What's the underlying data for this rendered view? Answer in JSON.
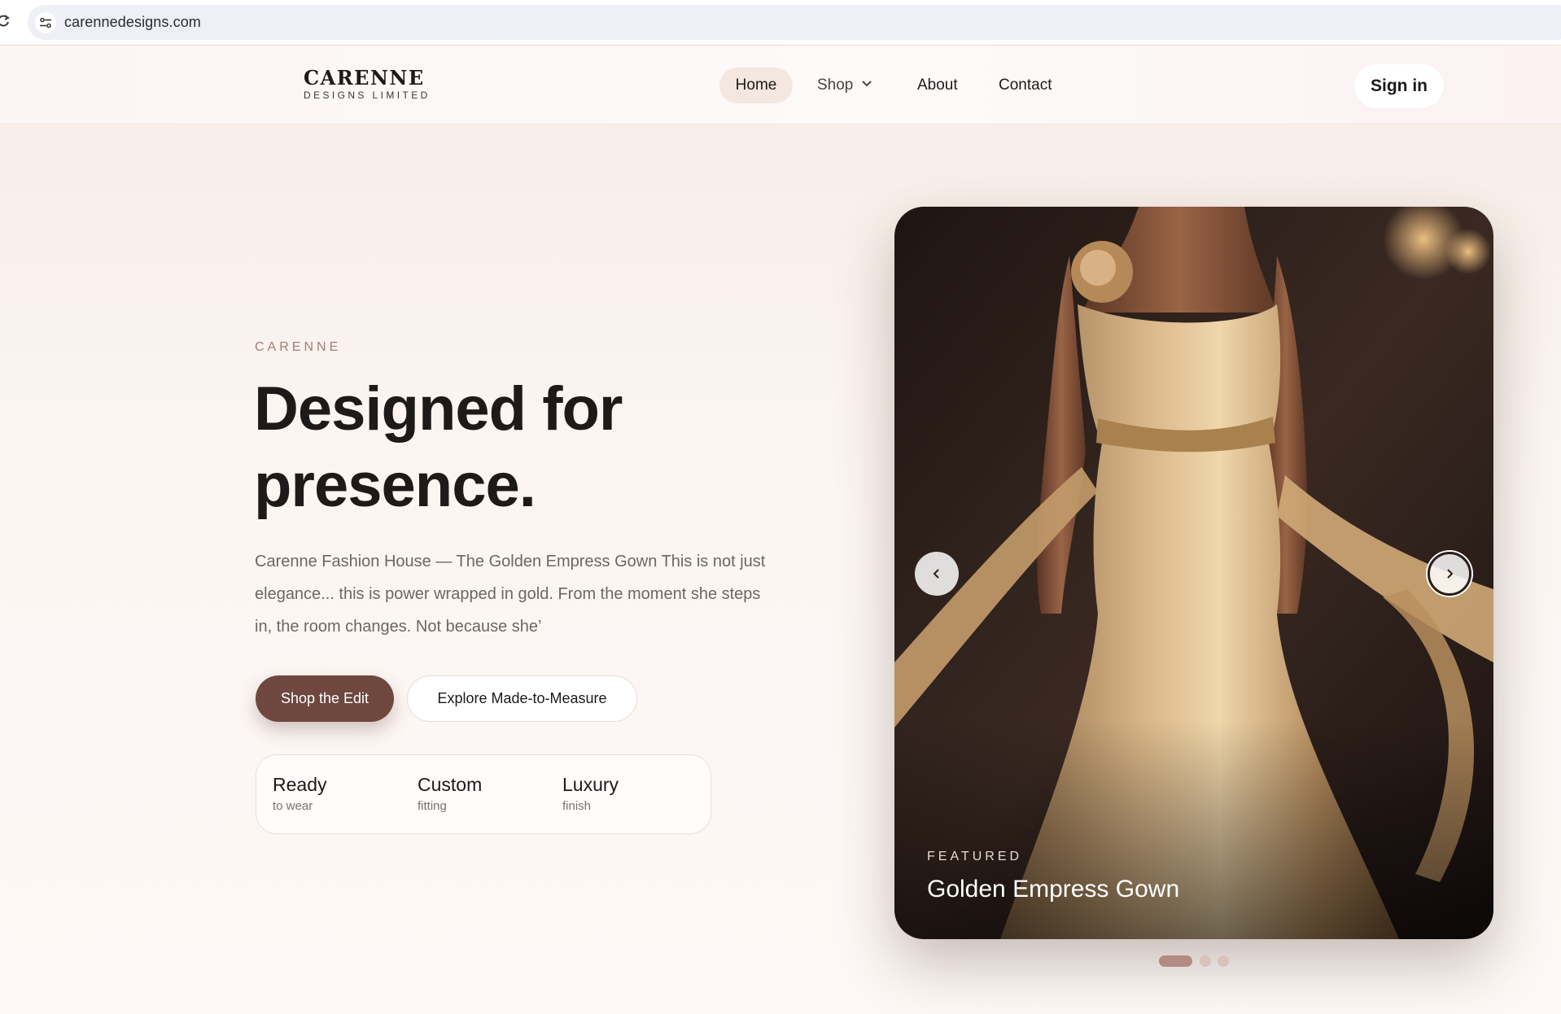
{
  "browser": {
    "url": "carennedesigns.com"
  },
  "header": {
    "logo_name": "CARENNE",
    "logo_sub": "DESIGNS LIMITED",
    "nav": {
      "home": "Home",
      "shop": "Shop",
      "about": "About",
      "contact": "Contact"
    },
    "signin": "Sign in"
  },
  "hero": {
    "eyebrow": "CARENNE",
    "title": "Designed for presence.",
    "description": "Carenne Fashion House — The Golden Empress Gown This is not just elegance... this is power wrapped in gold. From the moment she steps in, the room changes. Not because she’",
    "primary_button": "Shop the Edit",
    "secondary_button": "Explore Made-to-Measure",
    "features": [
      {
        "title": "Ready",
        "sub": "to wear"
      },
      {
        "title": "Custom",
        "sub": "fitting"
      },
      {
        "title": "Luxury",
        "sub": "finish"
      }
    ]
  },
  "carousel": {
    "label": "FEATURED",
    "title": "Golden Empress Gown",
    "slide_count": 3,
    "active_slide": 1,
    "icons": {
      "prev": "chevron-left-icon",
      "next": "chevron-right-icon"
    }
  },
  "colors": {
    "accent": "#6e473f",
    "background": "#fbf4f0",
    "dot_active": "#b48b82",
    "dot_inactive": "#d9c2bb",
    "gown_gold": "#c9a275"
  }
}
